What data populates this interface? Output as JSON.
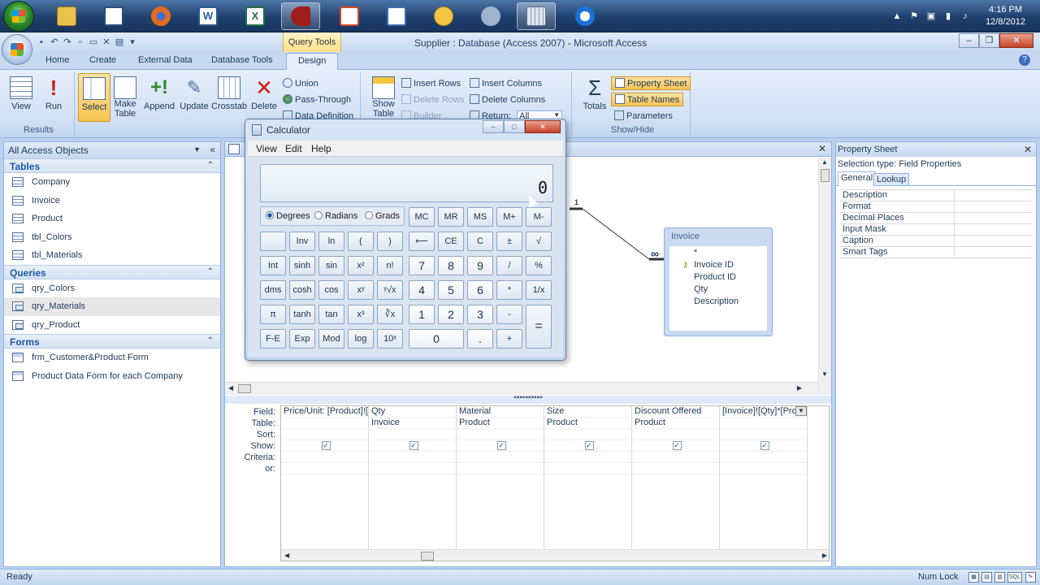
{
  "taskbar": {
    "apps": [
      {
        "name": "file-explorer-icon",
        "color": "#e8c24a"
      },
      {
        "name": "presentation-icon",
        "color": "#ffffff"
      },
      {
        "name": "firefox-icon",
        "color": "#e66a1c"
      },
      {
        "name": "word-icon",
        "color": "#2b5797"
      },
      {
        "name": "excel-icon",
        "color": "#1e7145"
      },
      {
        "name": "access-key-icon",
        "color": "#a01d1d"
      },
      {
        "name": "powerpoint-icon",
        "color": "#d24726"
      },
      {
        "name": "notebook-icon",
        "color": "#3a6fb6"
      },
      {
        "name": "outlook-icon",
        "color": "#f4c542"
      },
      {
        "name": "tools-icon",
        "color": "#9fb3cc"
      },
      {
        "name": "calculator-icon",
        "color": "#dfe6ef"
      },
      {
        "name": "teamviewer-icon",
        "color": "#1a74d8"
      }
    ],
    "time": "4:16 PM",
    "date": "12/8/2012"
  },
  "window": {
    "title": "Supplier : Database (Access 2007)  -  Microsoft Access",
    "context_tab": "Query Tools"
  },
  "ribbon": {
    "tabs": [
      "Home",
      "Create",
      "External Data",
      "Database Tools",
      "Design"
    ],
    "groups": {
      "results": {
        "label": "Results",
        "view": "View",
        "run": "Run"
      },
      "query_type": {
        "label": "Query Type",
        "select": "Select",
        "make_table_1": "Make",
        "make_table_2": "Table",
        "append": "Append",
        "update": "Update",
        "crosstab": "Crosstab",
        "delete": "Delete",
        "union": "Union",
        "pass_through": "Pass-Through",
        "data_definition": "Data Definition"
      },
      "query_setup": {
        "show_table_1": "Show",
        "show_table_2": "Table",
        "insert_rows": "Insert Rows",
        "delete_rows": "Delete Rows",
        "builder": "Builder",
        "insert_columns": "Insert Columns",
        "delete_columns": "Delete Columns",
        "return_label": "Return:",
        "return_value": "All"
      },
      "show_hide": {
        "label": "Show/Hide",
        "totals": "Totals",
        "property_sheet": "Property Sheet",
        "table_names": "Table Names",
        "parameters": "Parameters"
      }
    }
  },
  "nav": {
    "header": "All Access Objects",
    "tables_label": "Tables",
    "tables": [
      "Company",
      "Invoice",
      "Product",
      "tbl_Colors",
      "tbl_Materials"
    ],
    "queries_label": "Queries",
    "queries": [
      "qry_Colors",
      "qry_Materials",
      "qry_Product"
    ],
    "forms_label": "Forms",
    "forms": [
      "frm_Customer&Product Form",
      "Product Data Form for each Company"
    ]
  },
  "designer": {
    "relation_one": "1",
    "relation_many": "∞",
    "invoice_table": {
      "title": "Invoice",
      "fields": [
        "*",
        "Invoice ID",
        "Product ID",
        "Qty",
        "Description"
      ]
    },
    "grid_row_labels": [
      "Field:",
      "Table:",
      "Sort:",
      "Show:",
      "Criteria:",
      "or:"
    ],
    "columns": [
      {
        "field": "Price/Unit: [Product]![",
        "table": "",
        "show": true
      },
      {
        "field": "Qty",
        "table": "Invoice",
        "show": true
      },
      {
        "field": "Material",
        "table": "Product",
        "show": true
      },
      {
        "field": "Size",
        "table": "Product",
        "show": true
      },
      {
        "field": "Discount Offered",
        "table": "Product",
        "show": true
      },
      {
        "field": "[Invoice]![Qty]*[Pro",
        "table": "",
        "show": true
      }
    ]
  },
  "property_sheet": {
    "title": "Property Sheet",
    "selection_type": "Selection type:  Field Properties",
    "tabs": [
      "General",
      "Lookup"
    ],
    "properties": [
      "Description",
      "Format",
      "Decimal Places",
      "Input Mask",
      "Caption",
      "Smart Tags"
    ]
  },
  "status": {
    "text": "Ready",
    "numlock": "Num Lock"
  },
  "calculator": {
    "title": "Calculator",
    "menu": [
      "View",
      "Edit",
      "Help"
    ],
    "display": "0",
    "angle_modes": [
      "Degrees",
      "Radians",
      "Grads"
    ],
    "buttons": {
      "mc": "MC",
      "mr": "MR",
      "ms": "MS",
      "mplus": "M+",
      "mminus": "M-",
      "inv": "Inv",
      "ln": "ln",
      "lparen": "(",
      "rparen": ")",
      "back": "⟵",
      "ce": "CE",
      "c": "C",
      "pm": "±",
      "sqrt": "√",
      "int": "Int",
      "sinh": "sinh",
      "sin": "sin",
      "x2": "x²",
      "fact": "n!",
      "n7": "7",
      "n8": "8",
      "n9": "9",
      "div": "/",
      "pct": "%",
      "dms": "dms",
      "cosh": "cosh",
      "cos": "cos",
      "xy": "xʸ",
      "yroot": "ʸ√x",
      "n4": "4",
      "n5": "5",
      "n6": "6",
      "mul": "*",
      "recip": "1/x",
      "pi": "π",
      "tanh": "tanh",
      "tan": "tan",
      "x3": "x³",
      "cbrt": "∛x",
      "n1": "1",
      "n2": "2",
      "n3": "3",
      "sub": "-",
      "eq": "=",
      "fe": "F-E",
      "exp": "Exp",
      "mod": "Mod",
      "log": "log",
      "tenx": "10ˣ",
      "n0": "0",
      "dot": ".",
      "add": "+"
    }
  }
}
